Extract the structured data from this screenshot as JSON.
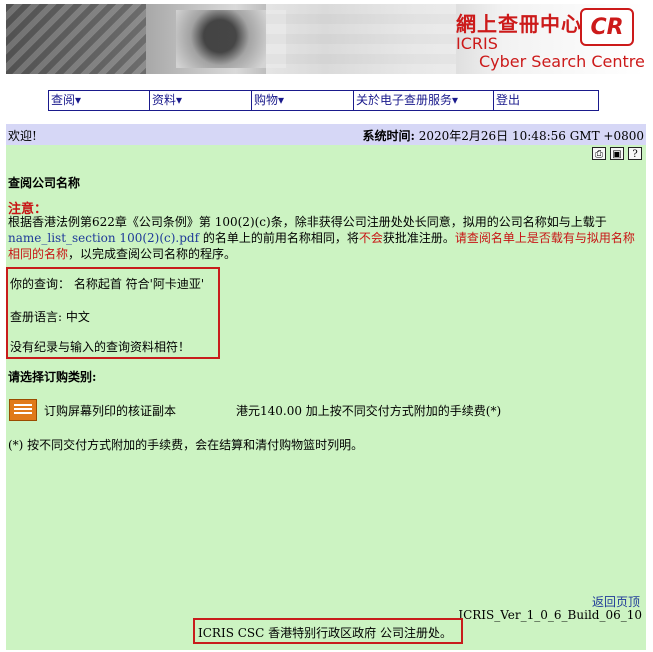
{
  "banner": {
    "logo_cn": "網上查冊中心",
    "logo_mark": "CR",
    "logo_en_1": "ICRIS",
    "logo_en_2": "Cyber Search Centre"
  },
  "menu": [
    {
      "label": "查阅▾"
    },
    {
      "label": "资料▾"
    },
    {
      "label": "购物▾"
    },
    {
      "label": "关於电子查册服务▾"
    },
    {
      "label": "登出"
    }
  ],
  "header": {
    "welcome": "欢迎!",
    "systime_label": "系统时间:",
    "systime_value": "2020年2月26日 10:48:56 GMT +0800"
  },
  "toolbar_icons": [
    "print-icon",
    "save-icon",
    "help-icon"
  ],
  "page_title": "查阅公司名称",
  "notice": {
    "label": "注意：",
    "part1": "根据香港法例第622章《公司条例》第 100(2)(c)条，除非获得公司注册处处长同意，拟用的公司名称如与上载于",
    "link": "name_list_section 100(2)(c).pdf",
    "part2": " 的名单上的前用名称相同，将",
    "red1": "不会",
    "part3": "获批准注册。",
    "red2": "请查阅名单上是否载有与拟用名称相同的名称",
    "part4": "，以完成查阅公司名称的程序。"
  },
  "query": {
    "line1": "你的查询： 名称起首 符合'阿卡迪亚'",
    "line2": "查册语言: 中文",
    "line3": "没有纪录与输入的查询资料相符！"
  },
  "order": {
    "label": "请选择订购类别:",
    "item": "订购屏幕列印的核证副本",
    "price": "港元140.00 加上按不同交付方式附加的手续费(*)",
    "note": "(*) 按不同交付方式附加的手续费，会在结算和清付购物篮时列明。"
  },
  "footer": {
    "back": "返回页顶",
    "version": "ICRIS_Ver_1_0_6_Build_06_10",
    "credit": "ICRIS CSC 香港特别行政区政府 公司注册处。"
  }
}
